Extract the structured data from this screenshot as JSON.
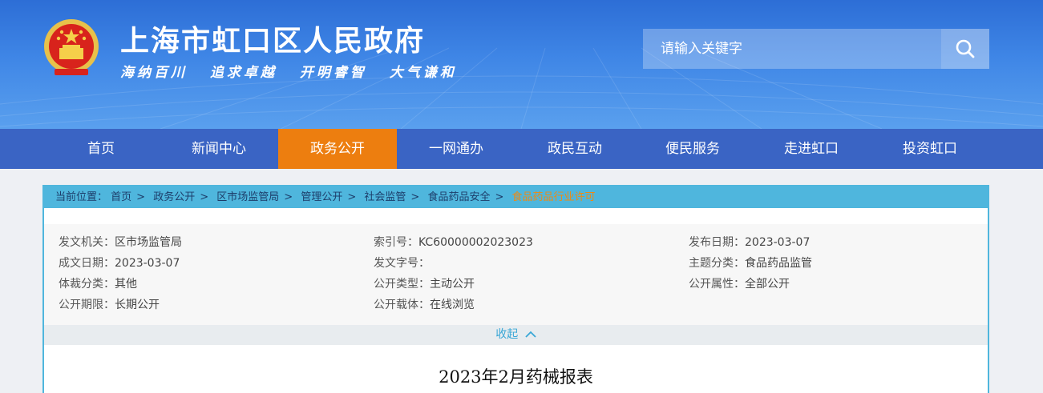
{
  "header": {
    "site_title": "上海市虹口区人民政府",
    "slogans": [
      "海纳百川",
      "追求卓越",
      "开明睿智",
      "大气谦和"
    ],
    "search": {
      "placeholder": "请输入关键字",
      "icon": "search-icon"
    },
    "emblem_icon": "national-emblem-icon"
  },
  "nav": {
    "items": [
      {
        "label": "首页"
      },
      {
        "label": "新闻中心"
      },
      {
        "label": "政务公开"
      },
      {
        "label": "一网通办"
      },
      {
        "label": "政民互动"
      },
      {
        "label": "便民服务"
      },
      {
        "label": "走进虹口"
      },
      {
        "label": "投资虹口"
      }
    ],
    "active_index": 2
  },
  "breadcrumb": {
    "prefix": "当前位置：",
    "items": [
      "首页",
      "政务公开",
      "区市场监管局",
      "管理公开",
      "社会监管",
      "食品药品安全"
    ],
    "current": "食品药品行业许可",
    "separator": ">"
  },
  "meta": {
    "issuer_label": "发文机关：",
    "issuer": "区市场监管局",
    "index_label": "索引号：",
    "index": "KC60000002023023",
    "publish_label": "发布日期：",
    "publish_date": "2023-03-07",
    "created_label": "成文日期：",
    "created_date": "2023-03-07",
    "docno_label": "发文字号：",
    "docno": "",
    "topic_label": "主题分类：",
    "topic": "食品药品监管",
    "genre_label": "体裁分类：",
    "genre": "其他",
    "opentype_label": "公开类型：",
    "opentype": "主动公开",
    "openattr_label": "公开属性：",
    "openattr": "全部公开",
    "openterm_label": "公开期限：",
    "openterm": "长期公开",
    "carrier_label": "公开载体：",
    "carrier": "在线浏览"
  },
  "collapse_label": "收起",
  "document": {
    "title": "2023年2月药械报表"
  },
  "colors": {
    "nav_bg": "#3a64c4",
    "nav_active": "#ed7e0f",
    "accent": "#4fb6dd",
    "crumb_current": "#f08a12"
  }
}
